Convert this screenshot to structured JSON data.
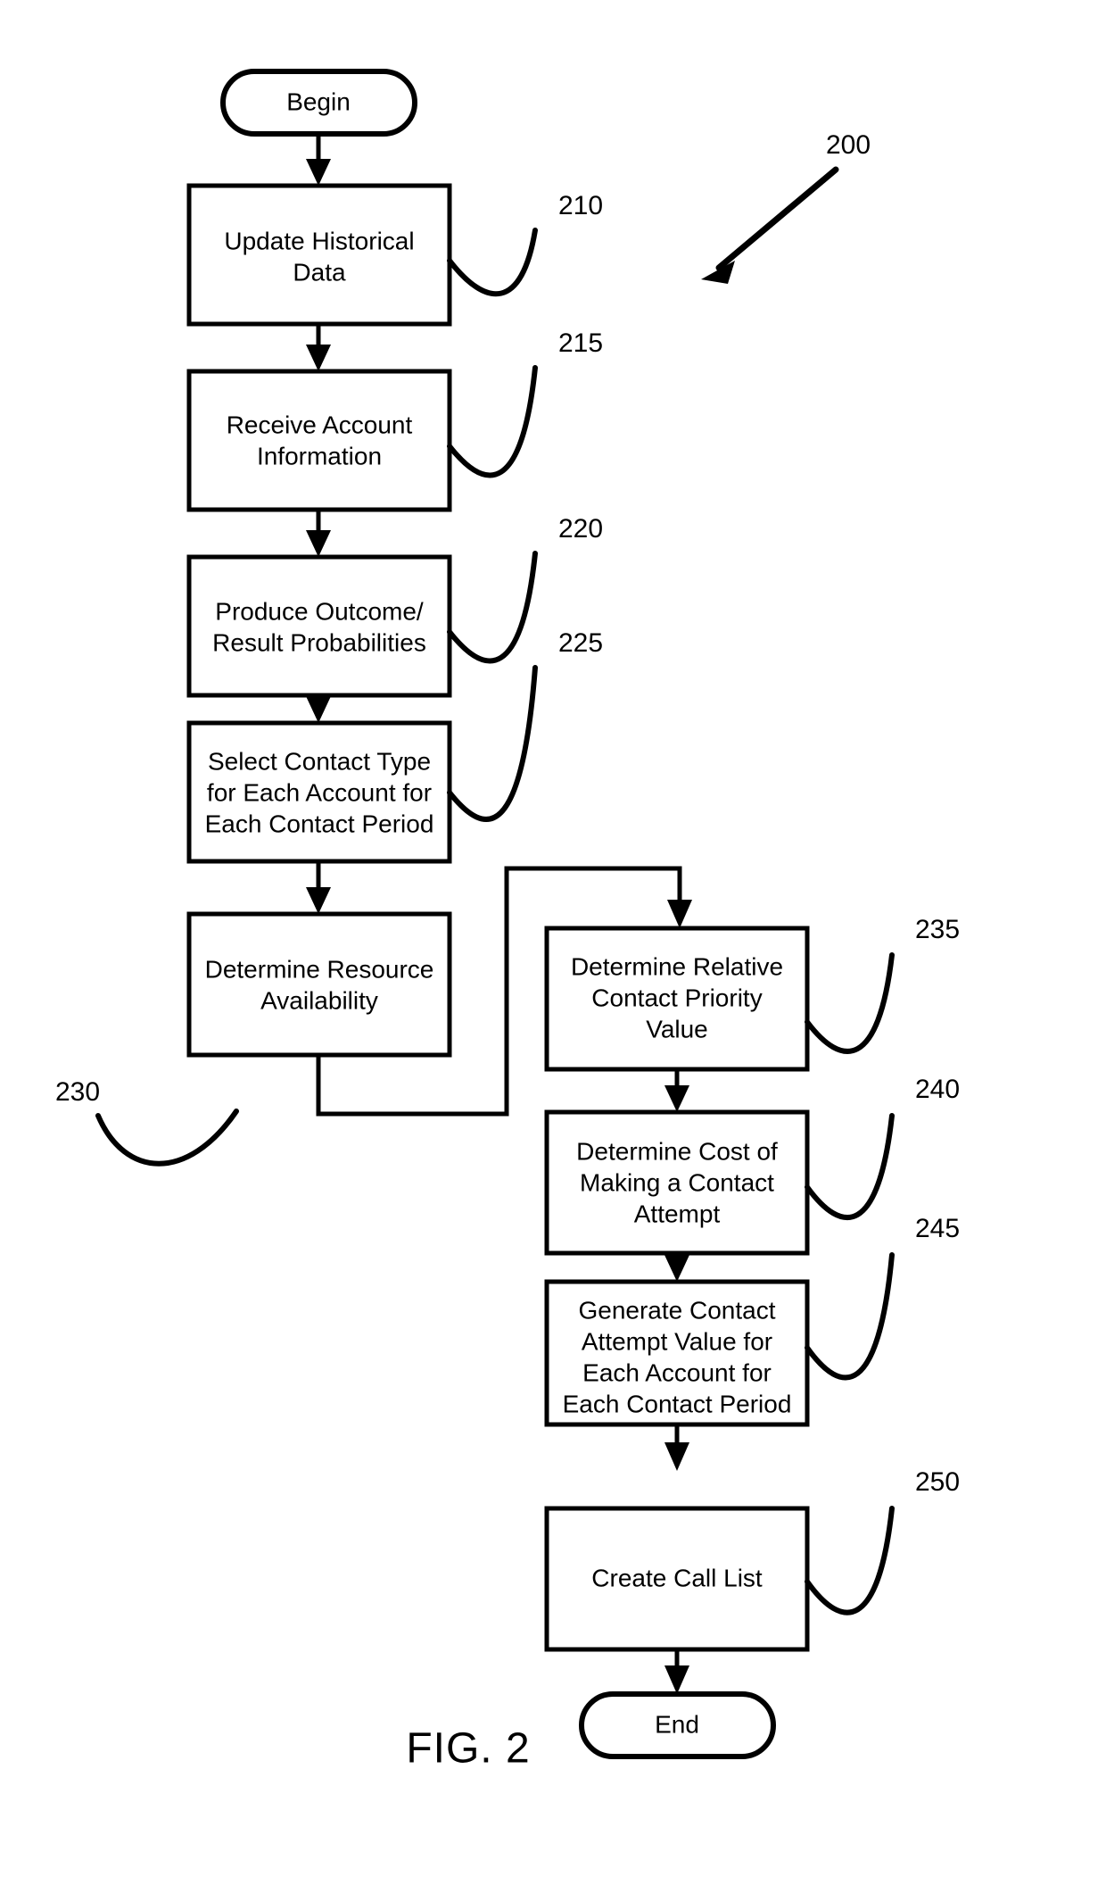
{
  "figure": {
    "caption": "FIG. 2",
    "diagram_reference": "200"
  },
  "terminators": {
    "begin": "Begin",
    "end": "End"
  },
  "left_column": [
    {
      "id": "update-historical-data",
      "lines": [
        "Update Historical",
        "Data"
      ],
      "ref": "210"
    },
    {
      "id": "receive-account-information",
      "lines": [
        "Receive Account",
        "Information"
      ],
      "ref": "215"
    },
    {
      "id": "produce-outcome-result-probabilities",
      "lines": [
        "Produce Outcome/",
        "Result Probabilities"
      ],
      "ref": "220"
    },
    {
      "id": "select-contact-type",
      "lines": [
        "Select Contact Type",
        "for Each Account for",
        "Each Contact Period"
      ],
      "ref": "225"
    },
    {
      "id": "determine-resource-availability",
      "lines": [
        "Determine Resource",
        "Availability"
      ],
      "ref": "230"
    }
  ],
  "right_column": [
    {
      "id": "determine-relative-contact-priority-value",
      "lines": [
        "Determine Relative",
        "Contact Priority",
        "Value"
      ],
      "ref": "235"
    },
    {
      "id": "determine-cost-of-making-a-contact-attempt",
      "lines": [
        "Determine Cost of",
        "Making a Contact",
        "Attempt"
      ],
      "ref": "240"
    },
    {
      "id": "generate-contact-attempt-value",
      "lines": [
        "Generate Contact",
        "Attempt Value for",
        "Each Account for",
        "Each Contact Period"
      ],
      "ref": "245"
    },
    {
      "id": "create-call-list",
      "lines": [
        "Create Call List"
      ],
      "ref": "250"
    }
  ],
  "colors": {
    "ink": "#000000",
    "paper": "#ffffff"
  }
}
